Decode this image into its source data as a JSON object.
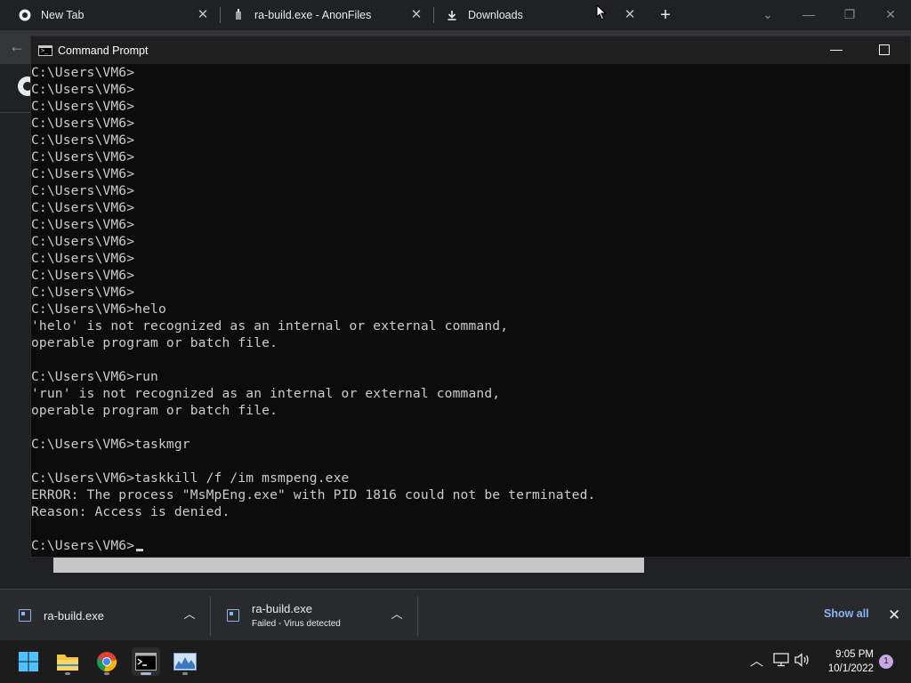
{
  "browser": {
    "tabs": [
      {
        "label": "New Tab",
        "icon": "chrome-icon"
      },
      {
        "label": "ra-build.exe - AnonFiles",
        "icon": "anonfiles-icon"
      },
      {
        "label": "Downloads",
        "icon": "download-icon"
      }
    ],
    "close_glyph": "✕",
    "new_tab_glyph": "+"
  },
  "cmd": {
    "title": "Command Prompt",
    "lines": [
      "C:\\Users\\VM6>",
      "C:\\Users\\VM6>",
      "C:\\Users\\VM6>",
      "C:\\Users\\VM6>",
      "C:\\Users\\VM6>",
      "C:\\Users\\VM6>",
      "C:\\Users\\VM6>",
      "C:\\Users\\VM6>",
      "C:\\Users\\VM6>",
      "C:\\Users\\VM6>",
      "C:\\Users\\VM6>",
      "C:\\Users\\VM6>",
      "C:\\Users\\VM6>",
      "C:\\Users\\VM6>",
      "C:\\Users\\VM6>helo",
      "'helo' is not recognized as an internal or external command,",
      "operable program or batch file.",
      "",
      "C:\\Users\\VM6>run",
      "'run' is not recognized as an internal or external command,",
      "operable program or batch file.",
      "",
      "C:\\Users\\VM6>taskmgr",
      "",
      "C:\\Users\\VM6>taskkill /f /im msmpeng.exe",
      "ERROR: The process \"MsMpEng.exe\" with PID 1816 could not be terminated.",
      "Reason: Access is denied.",
      "",
      "C:\\Users\\VM6>"
    ]
  },
  "downloads": {
    "items": [
      {
        "name": "ra-build.exe",
        "status": ""
      },
      {
        "name": "ra-build.exe",
        "status": "Failed - Virus detected"
      }
    ],
    "show_all": "Show all"
  },
  "taskbar": {
    "apps": [
      "windows-start-icon",
      "file-explorer-icon",
      "chrome-icon",
      "terminal-icon",
      "resource-monitor-icon"
    ],
    "time": "9:05 PM",
    "date": "10/1/2022",
    "notification_count": "1"
  },
  "colors": {
    "console_bg": "#0c0c0c",
    "console_text": "#cccccc",
    "accent_link": "#8ab4f8",
    "chrome_bg": "#202124"
  }
}
